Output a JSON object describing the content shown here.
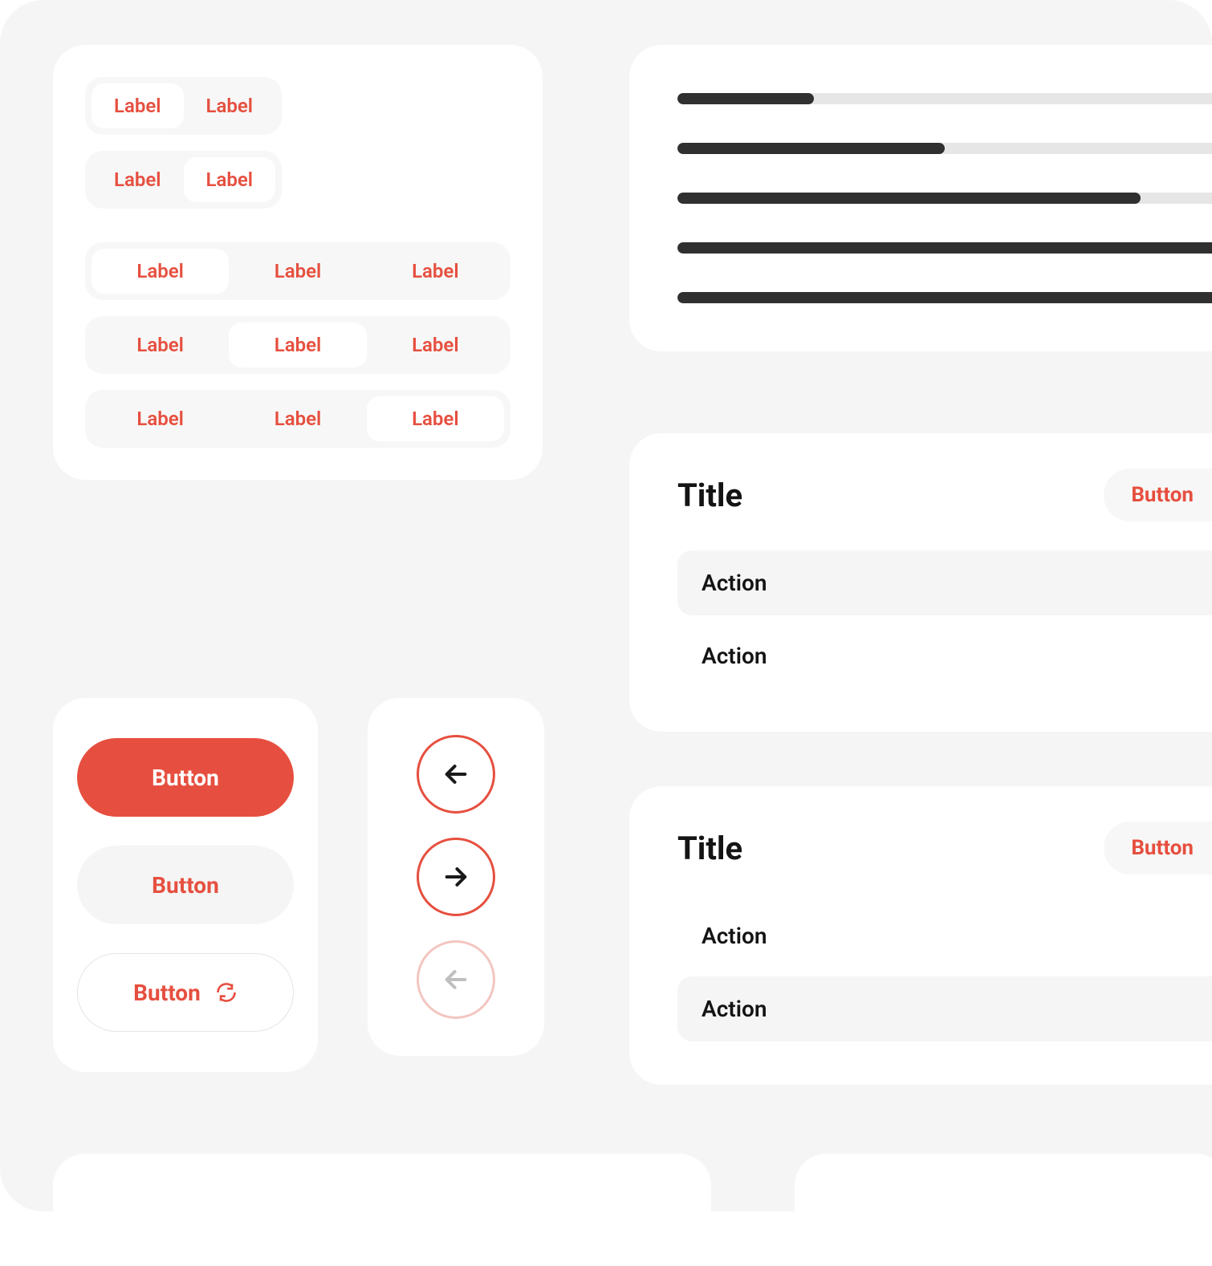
{
  "colors": {
    "accent": "#e64f3f",
    "track": "#e6e6e6",
    "fill": "#303030"
  },
  "segments": {
    "two_a": {
      "items": [
        "Label",
        "Label"
      ],
      "active": 0
    },
    "two_b": {
      "items": [
        "Label",
        "Label"
      ],
      "active": 1
    },
    "three_a": {
      "items": [
        "Label",
        "Label",
        "Label"
      ],
      "active": 0
    },
    "three_b": {
      "items": [
        "Label",
        "Label",
        "Label"
      ],
      "active": 1
    },
    "three_c": {
      "items": [
        "Label",
        "Label",
        "Label"
      ],
      "active": 2
    }
  },
  "buttons": {
    "primary": "Button",
    "secondary": "Button",
    "outline": "Button"
  },
  "nav": {
    "prev_enabled": true,
    "next_enabled": true,
    "prev_disabled_label": "previous (disabled)"
  },
  "progress": [
    23,
    45,
    78,
    100,
    100
  ],
  "panels": [
    {
      "title": "Title",
      "button": "Button",
      "actions": [
        "Action",
        "Action"
      ],
      "shaded_index": 0
    },
    {
      "title": "Title",
      "button": "Button",
      "actions": [
        "Action",
        "Action"
      ],
      "shaded_index": 1
    }
  ]
}
